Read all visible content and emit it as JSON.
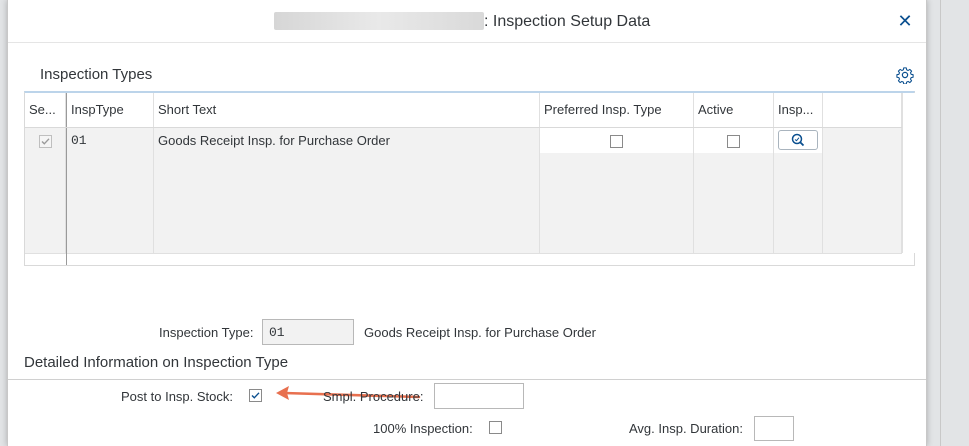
{
  "dialog": {
    "title": ": Inspection Setup Data",
    "close_symbol": "✕"
  },
  "insp_types": {
    "title": "Inspection Types",
    "settings_icon": "gear-icon",
    "columns": [
      "Se...",
      "InspType",
      "Short Text",
      "Preferred Insp. Type",
      "Active",
      "Insp..."
    ],
    "rows": [
      {
        "selected": true,
        "insp_type": "01",
        "short_text": "Goods Receipt Insp. for Purchase Order",
        "preferred": false,
        "active": false,
        "details_icon": "magnifier-icon"
      }
    ]
  },
  "detail": {
    "insp_type_label": "Inspection Type:",
    "insp_type_value": "01",
    "insp_type_desc": "Goods Receipt Insp. for Purchase Order",
    "section_title": "Detailed Information on Inspection Type",
    "post_to_stock_label": "Post to Insp. Stock:",
    "post_to_stock_checked": true,
    "smpl_procedure_label": "Smpl. Procedure:",
    "smpl_procedure_value": "",
    "hundred_pct_label": "100% Inspection:",
    "hundred_pct_checked": false,
    "avg_duration_label": "Avg. Insp. Duration:",
    "avg_duration_value": ""
  },
  "colors": {
    "accent": "#0a4f8f",
    "arrow": "#e8704f",
    "grid_header_rule": "#bcd4ea"
  }
}
